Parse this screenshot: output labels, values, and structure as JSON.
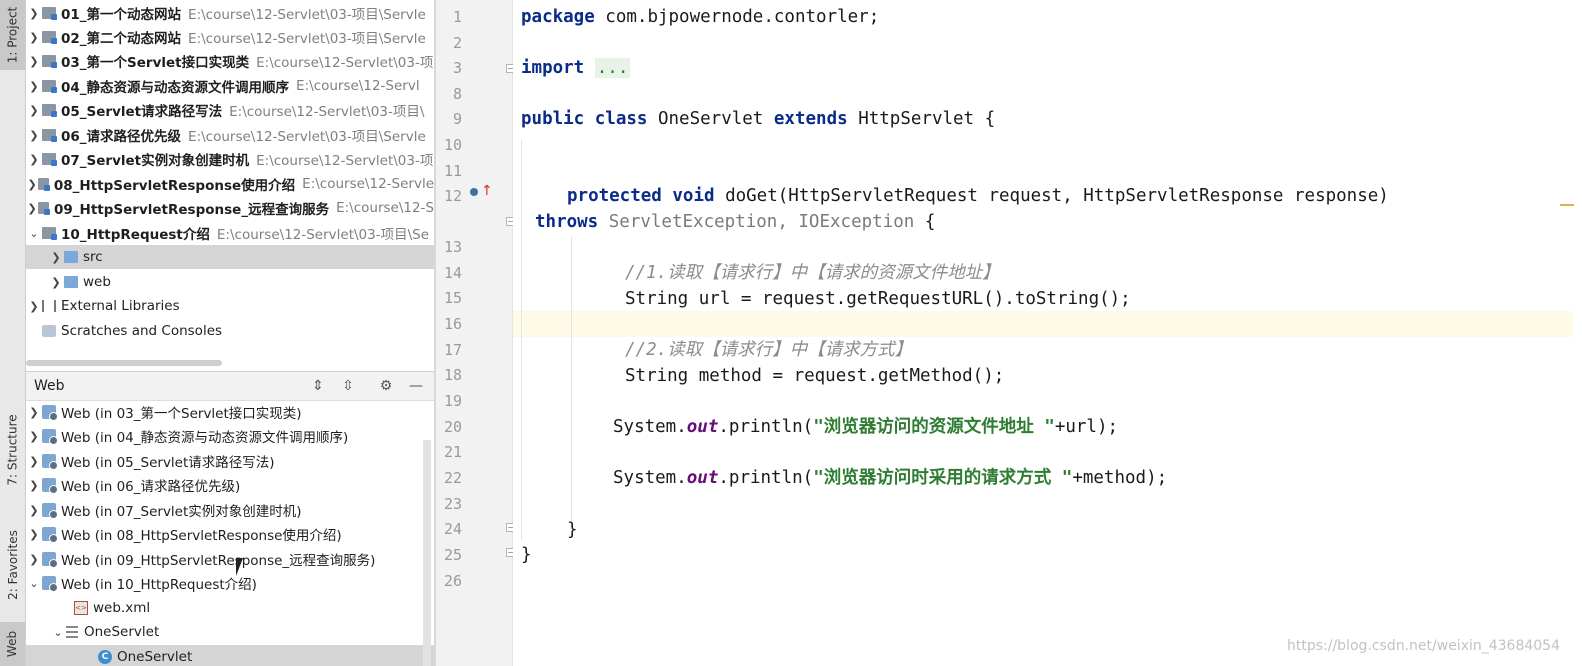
{
  "tool_strip": {
    "project_tab": "1: Project",
    "structure_tab": "7: Structure",
    "favorites_tab": "2: Favorites",
    "web_tab": "Web"
  },
  "project_tree": [
    {
      "name": "01_第一个动态网站",
      "path": "E:\\course\\12-Servlet\\03-项目\\Servle"
    },
    {
      "name": "02_第二个动态网站",
      "path": "E:\\course\\12-Servlet\\03-项目\\Servle"
    },
    {
      "name": "03_第一个Servlet接口实现类",
      "path": "E:\\course\\12-Servlet\\03-项"
    },
    {
      "name": "04_静态资源与动态资源文件调用顺序",
      "path": "E:\\course\\12-Servl"
    },
    {
      "name": "05_Servlet请求路径写法",
      "path": "E:\\course\\12-Servlet\\03-项目\\"
    },
    {
      "name": "06_请求路径优先级",
      "path": "E:\\course\\12-Servlet\\03-项目\\Servle"
    },
    {
      "name": "07_Servlet实例对象创建时机",
      "path": "E:\\course\\12-Servlet\\03-项"
    },
    {
      "name": "08_HttpServletResponse使用介绍",
      "path": "E:\\course\\12-Servle"
    },
    {
      "name": "09_HttpServletResponse_远程查询服务",
      "path": "E:\\course\\12-S"
    },
    {
      "name": "10_HttpRequest介绍",
      "path": "E:\\course\\12-Servlet\\03-项目\\Se"
    }
  ],
  "project_children": {
    "src": "src",
    "web": "web",
    "external": "External Libraries",
    "scratches": "Scratches and Consoles"
  },
  "web_panel": {
    "title": "Web",
    "items": [
      "Web (in 03_第一个Servlet接口实现类)",
      "Web (in 04_静态资源与动态资源文件调用顺序)",
      "Web (in 05_Servlet请求路径写法)",
      "Web (in 06_请求路径优先级)",
      "Web (in 07_Servlet实例对象创建时机)",
      "Web (in 08_HttpServletResponse使用介绍)",
      "Web (in 09_HttpServletResponse_远程查询服务)",
      "Web (in 10_HttpRequest介绍)"
    ],
    "web_xml": "web.xml",
    "servlet_group": "OneServlet",
    "servlet_item": "OneServlet"
  },
  "editor": {
    "line_numbers": [
      "1",
      "2",
      "3",
      "8",
      "9",
      "10",
      "11",
      "12",
      "",
      "13",
      "14",
      "15",
      "16",
      "17",
      "18",
      "19",
      "20",
      "21",
      "22",
      "23",
      "24",
      "25",
      "26"
    ],
    "code": {
      "l1_kw": "package",
      "l1_rest": " com.bjpowernode.contorler;",
      "l3_kw": "import",
      "l3_folded": "...",
      "l9_kw1": "public",
      "l9_kw2": "class",
      "l9_name": " OneServlet ",
      "l9_kw3": "extends",
      "l9_rest": " HttpServlet {",
      "l12_kw1": "protected",
      "l12_kw2": "void",
      "l12_rest": " doGet(HttpServletRequest request, HttpServletResponse response)",
      "l12b_kw": "throws",
      "l12b_grey": " ServletException, IOException",
      "l12b_rest": " {",
      "l14": "//1.读取【请求行】中【请求的资源文件地址】",
      "l15": "String url = request.getRequestURL().toString();",
      "l17": "//2.读取【请求行】中【请求方式】",
      "l18": "String method = request.getMethod();",
      "l20_a": "System.",
      "l20_out": "out",
      "l20_b": ".println(",
      "l20_str": "\"浏览器访问的资源文件地址 \"",
      "l20_c": "+url);",
      "l22_a": "System.",
      "l22_out": "out",
      "l22_b": ".println(",
      "l22_str": "\"浏览器访问时采用的请求方式 \"",
      "l22_c": "+method);",
      "l24": "}",
      "l25": "}"
    }
  },
  "watermark": "https://blog.csdn.net/weixin_43684054"
}
